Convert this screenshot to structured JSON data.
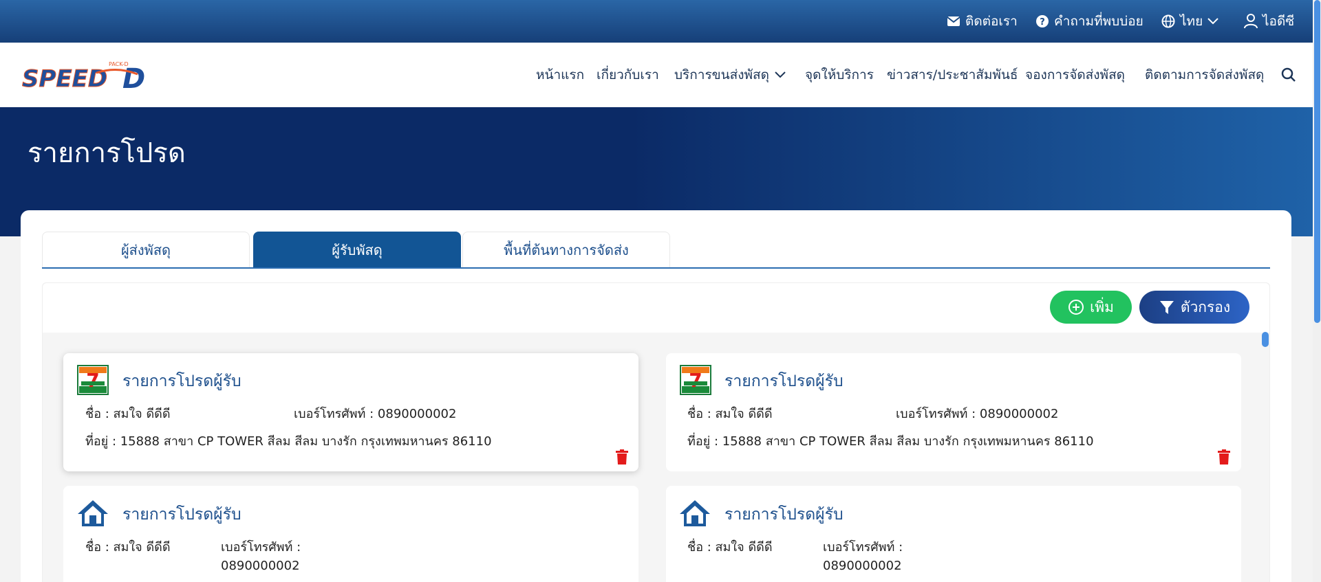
{
  "topbar": {
    "contact": "ติดต่อเรา",
    "faq": "คำถามที่พบบ่อย",
    "language": "ไทย",
    "user": "ไอดีซี"
  },
  "nav": {
    "home": "หน้าแรก",
    "about": "เกี่ยวกับเรา",
    "services": "บริการขนส่งพัสดุ",
    "service_points": "จุดให้บริการ",
    "news": "ข่าวสาร/ประชาสัมพันธ์",
    "booking": "จองการจัดส่งพัสดุ",
    "tracking": "ติดตามการจัดส่งพัสดุ"
  },
  "logo": {
    "text": "SPEED",
    "letter": "D",
    "tag": "PACK-D"
  },
  "hero": {
    "title": "รายการโปรด"
  },
  "tabs": [
    {
      "label": "ผู้ส่งพัสดุ",
      "active": false
    },
    {
      "label": "ผู้รับพัสดุ",
      "active": true
    },
    {
      "label": "พื้นที่ต้นทางการจัดส่ง",
      "active": false
    }
  ],
  "actions": {
    "add": "เพิ่ม",
    "filter": "ตัวกรอง"
  },
  "colors": {
    "brand": "#125595",
    "add": "#22c25f",
    "filter": "#1c3f84",
    "delete": "#e31b1b"
  },
  "cards": [
    {
      "icon": "seven-eleven-icon",
      "title": "รายการโปรดผู้รับ",
      "name": "ชื่อ : สมใจ ดีดีดี",
      "phone": "เบอร์โทรศัพท์ : 0890000002",
      "address": "ที่อยู่ : 15888 สาขา CP TOWER สีลม สีลม บางรัก กรุงเทพมหานคร 86110"
    },
    {
      "icon": "seven-eleven-icon",
      "title": "รายการโปรดผู้รับ",
      "name": "ชื่อ : สมใจ ดีดีดี",
      "phone": "เบอร์โทรศัพท์ : 0890000002",
      "address": "ที่อยู่ : 15888 สาขา CP TOWER สีลม สีลม บางรัก กรุงเทพมหานคร 86110"
    },
    {
      "icon": "house-icon",
      "title": "รายการโปรดผู้รับ",
      "name": "ชื่อ : สมใจ ดีดีดี",
      "phone_label": "เบอร์โทรศัพท์ :",
      "phone_value": "0890000002"
    },
    {
      "icon": "house-icon",
      "title": "รายการโปรดผู้รับ",
      "name": "ชื่อ : สมใจ ดีดีดี",
      "phone_label": "เบอร์โทรศัพท์ :",
      "phone_value": "0890000002"
    }
  ]
}
